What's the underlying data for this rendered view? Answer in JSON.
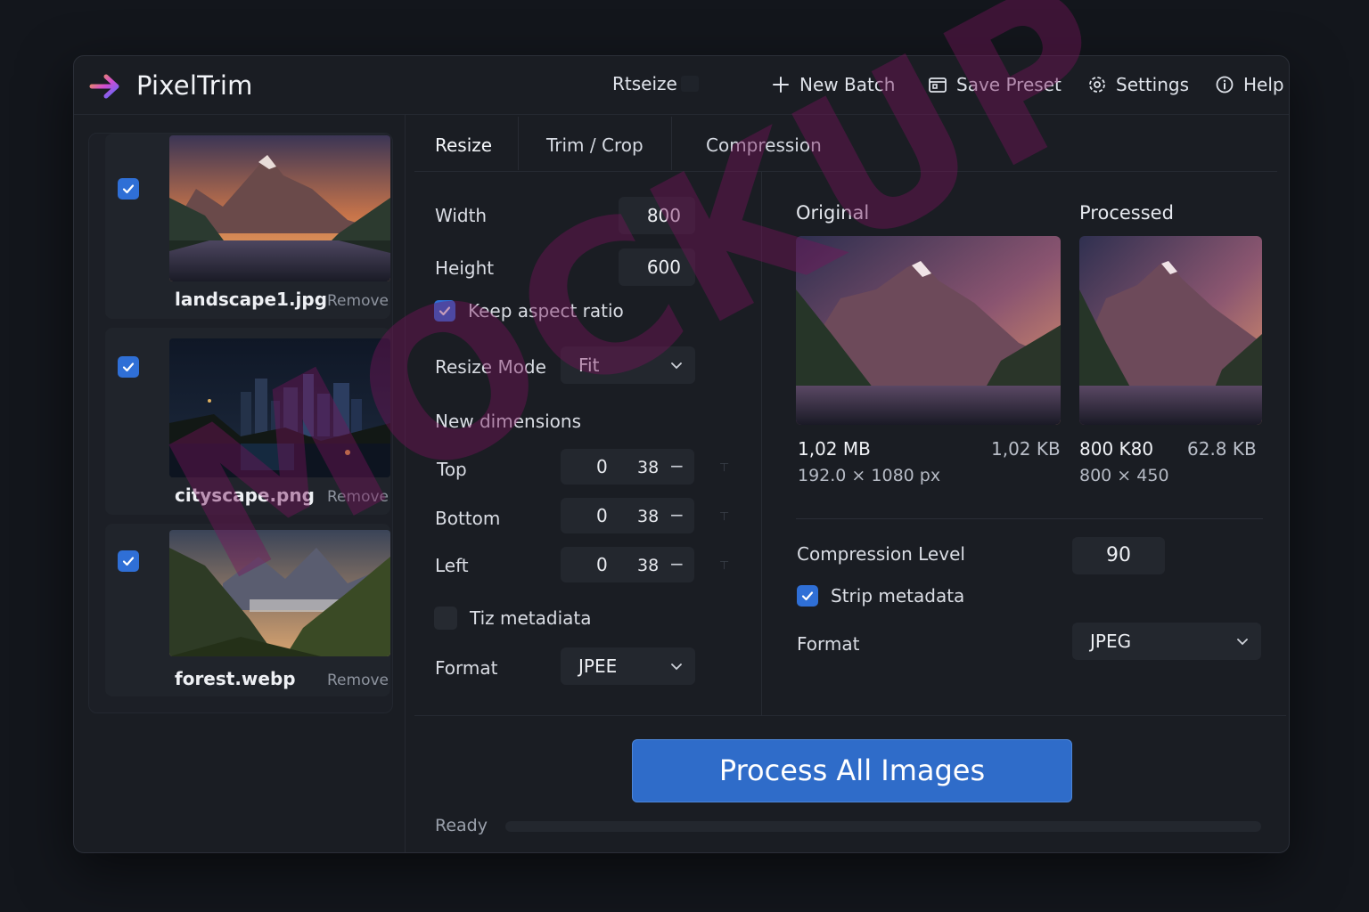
{
  "app": {
    "name": "PixelTrim"
  },
  "header": {
    "rtseize": "Rtseize",
    "new_batch": "New Batch",
    "save_preset": "Save Preset",
    "settings": "Settings",
    "help": "Help"
  },
  "files": [
    {
      "name": "landscape1.jpg",
      "remove": "Remove",
      "checked": true,
      "thumb": "mountain-lake-sunset"
    },
    {
      "name": "cityscape.png",
      "remove": "Remove",
      "checked": true,
      "thumb": "city-night"
    },
    {
      "name": "forest.webp",
      "remove": "Remove",
      "checked": true,
      "thumb": "forest-valley"
    }
  ],
  "tabs": [
    {
      "label": "Resize",
      "active": true
    },
    {
      "label": "Trim / Crop",
      "active": false
    },
    {
      "label": "Compression",
      "active": false
    }
  ],
  "resize": {
    "width_label": "Width",
    "width_value": "800",
    "height_label": "Height",
    "height_value": "600",
    "keep_aspect_label": "Keep aspect ratio",
    "keep_aspect_checked": true,
    "mode_label": "Resize Mode",
    "mode_value": "Fit",
    "new_dimensions_label": "New dimensions",
    "trim": [
      {
        "label": "Top",
        "value": "0",
        "value2": "38",
        "minus": "−",
        "tick": "⊤"
      },
      {
        "label": "Bottom",
        "value": "0",
        "value2": "38",
        "minus": "−",
        "tick": "⊤"
      },
      {
        "label": "Left",
        "value": "0",
        "value2": "38",
        "minus": "−",
        "tick": "⊤"
      }
    ],
    "metadata_label": "Tiz metadiata",
    "metadata_checked": false,
    "format_label": "Format",
    "format_value": "JPEE"
  },
  "preview": {
    "original_title": "Original",
    "processed_title": "Processed",
    "original_size": "1,02 MB",
    "original_size_alt": "1,02 KB",
    "original_dims": "192.0 × 1080 px",
    "processed_size": "800 K80",
    "processed_size_alt": "62.8 KB",
    "processed_dims": "800 × 450",
    "compression_label": "Compression Level",
    "compression_value": "90",
    "strip_label": "Strip metadata",
    "strip_checked": true,
    "format_label": "Format",
    "format_value": "JPEG"
  },
  "actions": {
    "process_all": "Process All Images"
  },
  "status": {
    "text": "Ready",
    "progress_fraction": 0.0
  },
  "watermark": "MOCKUP",
  "colors": {
    "accent": "#2f6cc9",
    "checkbox": "#2f6fd6",
    "background": "#1a1d23",
    "watermark": "#78145a"
  }
}
